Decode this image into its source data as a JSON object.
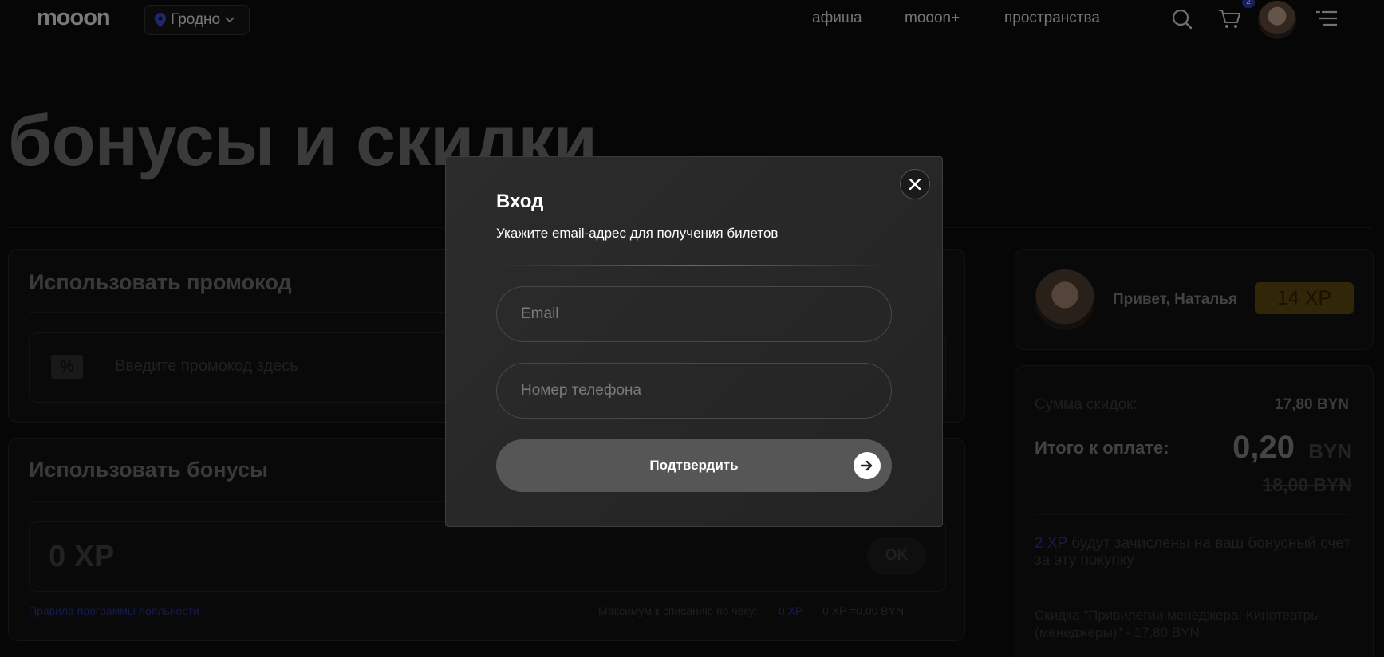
{
  "header": {
    "logo": "mooon",
    "city": "Гродно",
    "nav": [
      "афиша",
      "mooon+",
      "пространства"
    ],
    "cart_count": "2"
  },
  "page": {
    "title": "бонусы и скидки"
  },
  "promo": {
    "heading": "Использовать промокод",
    "icon_glyph": "%",
    "placeholder": "Введите промокод здесь"
  },
  "bonuses": {
    "heading": "Использовать бонусы",
    "value": "0 XP",
    "ok_label": "OK",
    "loyalty_link": "Правила программы лояльности",
    "max_label": "Максимум к списанию по чеку:",
    "max_value": "0 XP",
    "max_conversion": "0 XP =0,00 BYN"
  },
  "profile": {
    "greeting": "Привет, Наталья",
    "xp_badge": "14 XP"
  },
  "summary": {
    "discount_label": "Сумма скидок:",
    "discount_value": "17,80 BYN",
    "total_label": "Итого к оплате:",
    "total_amount": "0,20",
    "total_currency": "BYN",
    "old_price": "18,00 BYN",
    "bonus_xp": "2 XP",
    "bonus_text": "будут зачислены на ваш бонусный счет за эту покупку",
    "discount_note": "Скидка \"Привилегии менеджера: Кинотеатры (менеджеры)\" - 17,80 BYN"
  },
  "modal": {
    "title": "Вход",
    "subtitle": "Укажите email-адрес для получения билетов",
    "email_placeholder": "Email",
    "phone_placeholder": "Номер телефона",
    "confirm_label": "Подтвердить"
  },
  "colors": {
    "accent": "#2d3aa8",
    "xp_badge": "#5c4610",
    "background": "#0c0c0c"
  }
}
